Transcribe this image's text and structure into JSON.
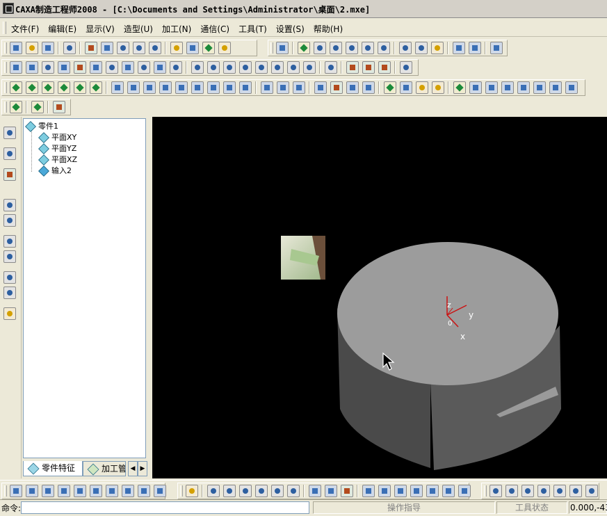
{
  "window": {
    "title": "CAXA制造工程师2008  - [C:\\Documents and Settings\\Administrator\\桌面\\2.mxe]"
  },
  "menu": {
    "items": [
      "文件(F)",
      "编辑(E)",
      "显示(V)",
      "造型(U)",
      "加工(N)",
      "通信(C)",
      "工具(T)",
      "设置(S)",
      "帮助(H)"
    ]
  },
  "toolbars": {
    "standard": [
      "new-file-icon",
      "open-folder-icon",
      "save-icon",
      "print-icon",
      "cut-icon",
      "copy-icon",
      "paste-icon",
      "undo-icon",
      "redo-icon"
    ],
    "view": [
      "light-bulb-icon",
      "lightning-icon",
      "filter-icon",
      "layers-icon",
      "window-icon",
      "zoom-window-icon",
      "zoom-icon",
      "zoom-in-icon",
      "dynamic-zoom-icon",
      "rotate-icon",
      "pan-icon",
      "wireframe-icon",
      "hidden-line-icon",
      "shaded-icon",
      "cascade-window-icon",
      "tile-window-icon",
      "flashlight-icon"
    ]
  },
  "tree": {
    "root": "零件1",
    "children": [
      "平面XY",
      "平面YZ",
      "平面XZ",
      "输入2"
    ]
  },
  "panel_tabs": {
    "active": "零件特征",
    "inactive": "加工管"
  },
  "viewport": {
    "background_color": "#000000",
    "axis_labels": {
      "z": "z",
      "y": "y",
      "origin": "0",
      "x": "x"
    },
    "axis_color": "#cc1111"
  },
  "status": {
    "command_label": "命令:",
    "command_value": "",
    "operation_hint": "操作指导",
    "tool_state": "工具状态",
    "coordinates": "0.000,-43"
  }
}
